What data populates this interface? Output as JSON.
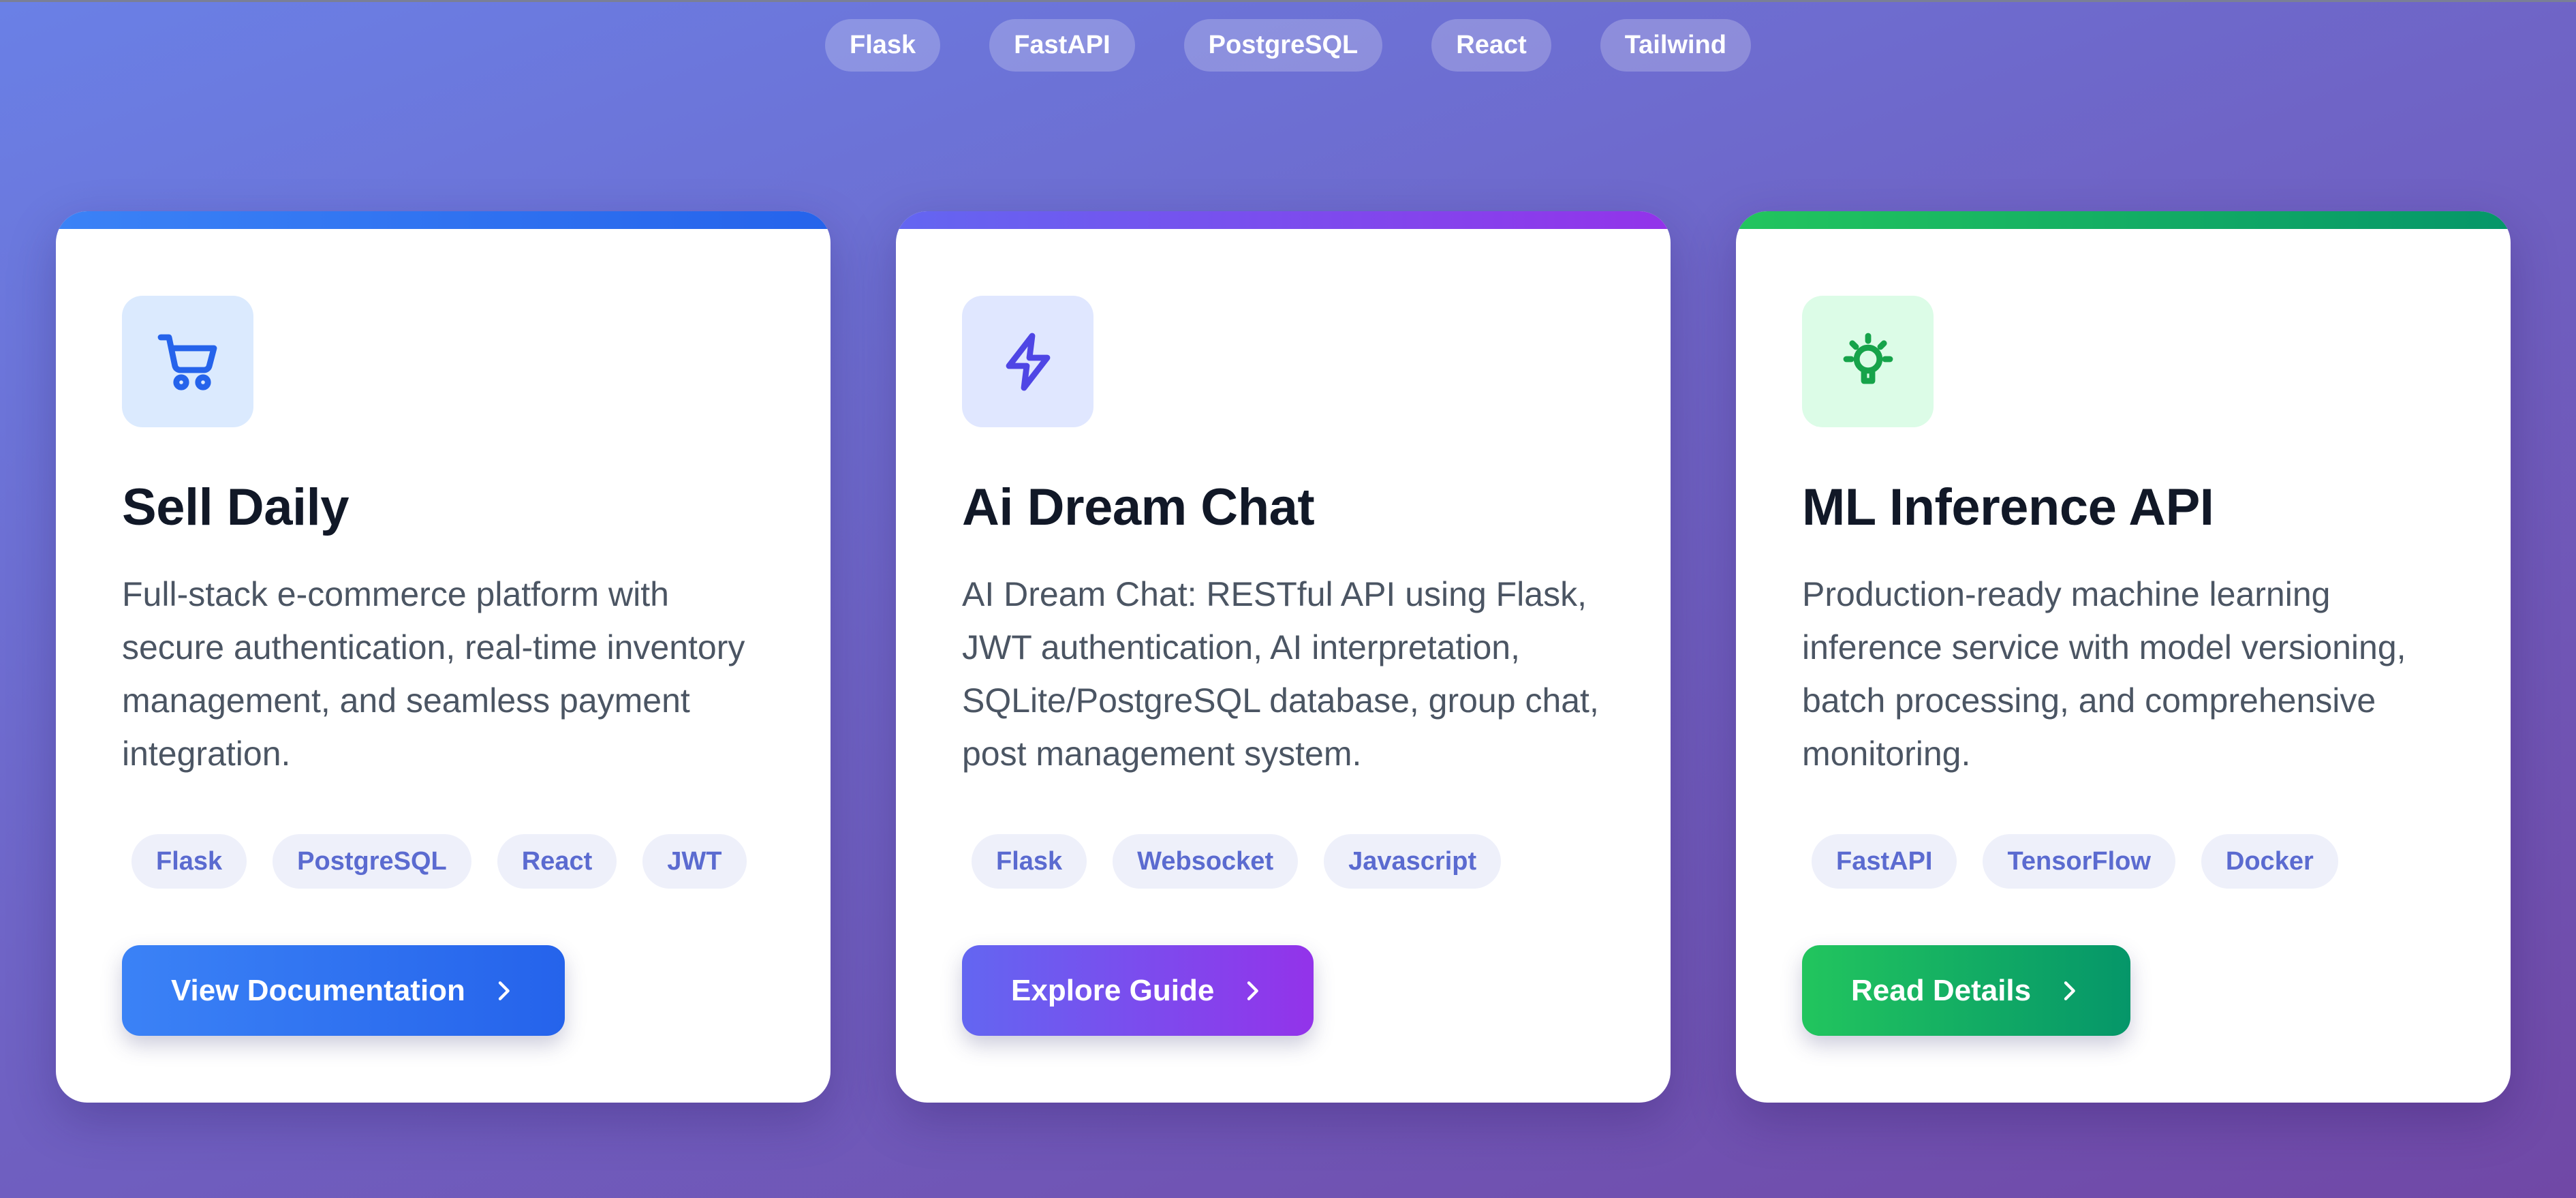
{
  "tech_strip": [
    "Flask",
    "FastAPI",
    "PostgreSQL",
    "React",
    "Tailwind"
  ],
  "cards": [
    {
      "icon": "shopping-cart-icon",
      "accent": "#2563eb",
      "title": "Sell Daily",
      "description": "Full-stack e-commerce platform with secure authentication, real-time inventory management, and seamless payment integration.",
      "tags": [
        "Flask",
        "PostgreSQL",
        "React",
        "JWT"
      ],
      "button_label": "View Documentation"
    },
    {
      "icon": "lightning-bolt-icon",
      "accent": "#7c3aed",
      "title": "Ai Dream Chat",
      "description": "AI Dream Chat: RESTful API using Flask, JWT authentication, AI interpretation, SQLite/PostgreSQL database, group chat, post management system.",
      "tags": [
        "Flask",
        "Websocket",
        "Javascript"
      ],
      "button_label": "Explore Guide"
    },
    {
      "icon": "lightbulb-icon",
      "accent": "#16a34a",
      "title": "ML Inference API",
      "description": "Production-ready machine learning inference service with model versioning, batch processing, and comprehensive monitoring.",
      "tags": [
        "FastAPI",
        "TensorFlow",
        "Docker"
      ],
      "button_label": "Read Details"
    }
  ]
}
